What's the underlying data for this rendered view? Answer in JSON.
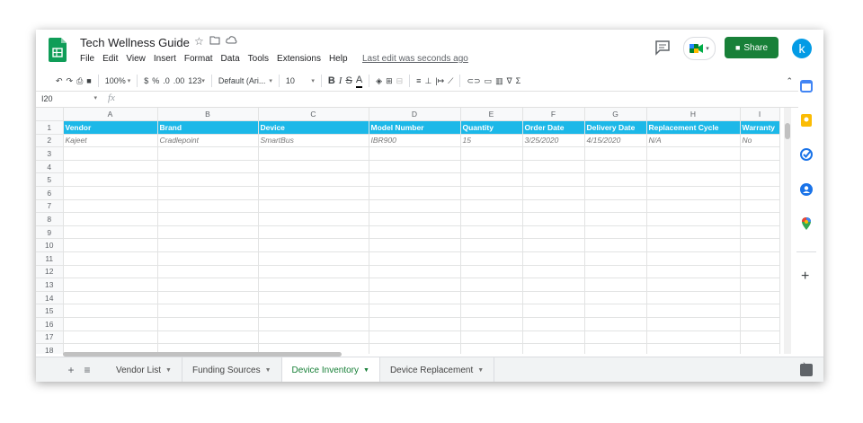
{
  "doc": {
    "title": "Tech Wellness Guide",
    "last_edit": "Last edit was seconds ago"
  },
  "menu": [
    "File",
    "Edit",
    "View",
    "Insert",
    "Format",
    "Data",
    "Tools",
    "Extensions",
    "Help"
  ],
  "header": {
    "share_label": "Share",
    "avatar_letter": "k"
  },
  "toolbar": {
    "zoom": "100%",
    "currency": "$",
    "percent": "%",
    "dec_less": ".0",
    "dec_more": ".00",
    "format_more": "123",
    "font": "Default (Ari...",
    "font_size": "10",
    "bold": "B",
    "italic": "I",
    "strike": "S",
    "text_color": "A",
    "functions": "Σ"
  },
  "formula_bar": {
    "cell_ref": "I20",
    "fx": "fx"
  },
  "columns": [
    "A",
    "B",
    "C",
    "D",
    "E",
    "F",
    "G",
    "H",
    "I"
  ],
  "rows": [
    [
      "Vendor",
      "Brand",
      "Device",
      "Model Number",
      "Quantity",
      "Order Date",
      "Delivery Date",
      "Replacement Cycle",
      "Warranty"
    ],
    [
      "Kajeet",
      "Cradlepoint",
      "SmartBus",
      "IBR900",
      "15",
      "3/25/2020",
      "4/15/2020",
      "N/A",
      "No"
    ],
    [
      "",
      "",
      "",
      "",
      "",
      "",
      "",
      "",
      ""
    ],
    [
      "",
      "",
      "",
      "",
      "",
      "",
      "",
      "",
      ""
    ],
    [
      "",
      "",
      "",
      "",
      "",
      "",
      "",
      "",
      ""
    ],
    [
      "",
      "",
      "",
      "",
      "",
      "",
      "",
      "",
      ""
    ],
    [
      "",
      "",
      "",
      "",
      "",
      "",
      "",
      "",
      ""
    ],
    [
      "",
      "",
      "",
      "",
      "",
      "",
      "",
      "",
      ""
    ],
    [
      "",
      "",
      "",
      "",
      "",
      "",
      "",
      "",
      ""
    ],
    [
      "",
      "",
      "",
      "",
      "",
      "",
      "",
      "",
      ""
    ],
    [
      "",
      "",
      "",
      "",
      "",
      "",
      "",
      "",
      ""
    ],
    [
      "",
      "",
      "",
      "",
      "",
      "",
      "",
      "",
      ""
    ],
    [
      "",
      "",
      "",
      "",
      "",
      "",
      "",
      "",
      ""
    ],
    [
      "",
      "",
      "",
      "",
      "",
      "",
      "",
      "",
      ""
    ],
    [
      "",
      "",
      "",
      "",
      "",
      "",
      "",
      "",
      ""
    ],
    [
      "",
      "",
      "",
      "",
      "",
      "",
      "",
      "",
      ""
    ],
    [
      "",
      "",
      "",
      "",
      "",
      "",
      "",
      "",
      ""
    ],
    [
      "",
      "",
      "",
      "",
      "",
      "",
      "",
      "",
      ""
    ]
  ],
  "row_numbers": [
    "1",
    "2",
    "3",
    "4",
    "5",
    "6",
    "7",
    "8",
    "9",
    "10",
    "11",
    "12",
    "13",
    "14",
    "15",
    "16",
    "17",
    "18"
  ],
  "tabs": [
    {
      "label": "Vendor List",
      "active": false
    },
    {
      "label": "Funding Sources",
      "active": false
    },
    {
      "label": "Device Inventory",
      "active": true
    },
    {
      "label": "Device Replacement",
      "active": false
    }
  ],
  "colors": {
    "header_fill": "#1cb8e8",
    "share_green": "#188038",
    "active_tab": "#188038"
  },
  "side_panel_icons": [
    "calendar-icon",
    "keep-icon",
    "tasks-icon",
    "contacts-icon",
    "maps-icon",
    "add-icon"
  ]
}
